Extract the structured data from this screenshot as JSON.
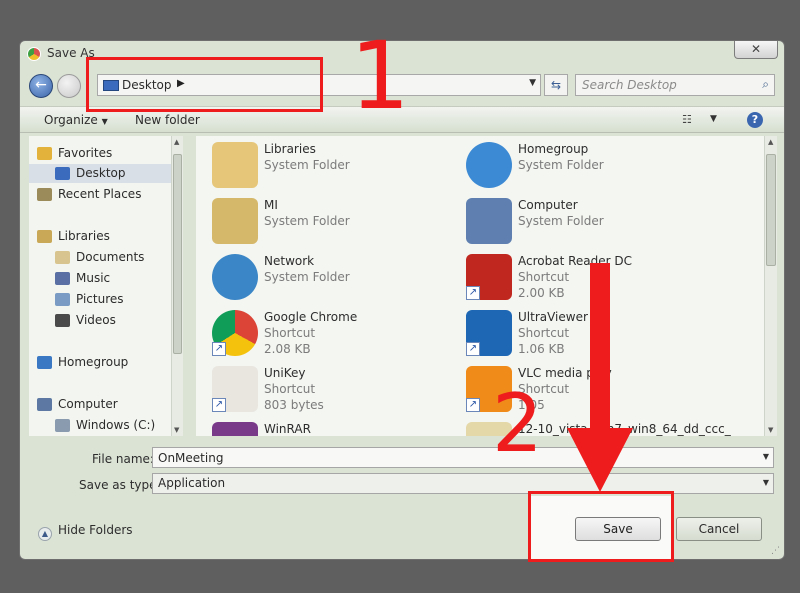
{
  "window": {
    "title": "Save As",
    "close_label": "✕"
  },
  "address_bar": {
    "path": "Desktop"
  },
  "search": {
    "placeholder": "Search Desktop"
  },
  "toolbar": {
    "organize_label": "Organize",
    "new_folder_label": "New folder",
    "help_label": "?"
  },
  "nav_pane": {
    "items": [
      {
        "label": "Favorites",
        "icon": "star-icon",
        "color": "#e2b23a"
      },
      {
        "label": "Desktop",
        "icon": "desktop-icon",
        "color": "#3b6bbd",
        "selected": true
      },
      {
        "label": "Recent Places",
        "icon": "recent-places-icon",
        "color": "#9b8b5a"
      },
      {
        "label": "Libraries",
        "icon": "libraries-icon",
        "color": "#c9a857"
      },
      {
        "label": "Documents",
        "icon": "documents-icon",
        "color": "#d8c48e"
      },
      {
        "label": "Music",
        "icon": "music-icon",
        "color": "#5a6fa3"
      },
      {
        "label": "Pictures",
        "icon": "pictures-icon",
        "color": "#7a9cc4"
      },
      {
        "label": "Videos",
        "icon": "videos-icon",
        "color": "#4a4a4a"
      },
      {
        "label": "Homegroup",
        "icon": "homegroup-icon",
        "color": "#3a78c4"
      },
      {
        "label": "Computer",
        "icon": "computer-icon",
        "color": "#5d79a3"
      },
      {
        "label": "Windows (C:)",
        "icon": "drive-icon",
        "color": "#8a9bb0"
      }
    ]
  },
  "files": [
    {
      "name": "Libraries",
      "type": "System Folder",
      "size": "",
      "icon": "libraries-folder-icon",
      "color": "#e6c77a",
      "shortcut": false
    },
    {
      "name": "Homegroup",
      "type": "System Folder",
      "size": "",
      "icon": "homegroup-icon",
      "color": "#3d8ad4",
      "shortcut": false
    },
    {
      "name": "MI",
      "type": "System Folder",
      "size": "",
      "icon": "user-folder-icon",
      "color": "#d6b86b",
      "shortcut": false
    },
    {
      "name": "Computer",
      "type": "System Folder",
      "size": "",
      "icon": "computer-icon",
      "color": "#5e7fb0",
      "shortcut": false
    },
    {
      "name": "Network",
      "type": "System Folder",
      "size": "",
      "icon": "network-icon",
      "color": "#3b86c6",
      "shortcut": false
    },
    {
      "name": "Acrobat Reader DC",
      "type": "Shortcut",
      "size": "2.00 KB",
      "icon": "acrobat-icon",
      "color": "#c0281f",
      "shortcut": true
    },
    {
      "name": "Google Chrome",
      "type": "Shortcut",
      "size": "2.08 KB",
      "icon": "chrome-icon",
      "color": "#d84a3a",
      "shortcut": true
    },
    {
      "name": "UltraViewer",
      "type": "Shortcut",
      "size": "1.06 KB",
      "icon": "ultraviewer-icon",
      "color": "#1e67b5",
      "shortcut": true
    },
    {
      "name": "UniKey",
      "type": "Shortcut",
      "size": "803 bytes",
      "icon": "unikey-icon",
      "color": "#e9e6e0",
      "shortcut": true
    },
    {
      "name": "VLC media play",
      "type": "Shortcut",
      "size": "1.05",
      "icon": "vlc-icon",
      "color": "#f08a18",
      "shortcut": true
    },
    {
      "name": "WinRAR",
      "type": "",
      "size": "",
      "icon": "winrar-icon",
      "color": "#7a3a8a",
      "shortcut": false
    },
    {
      "name": "12-10_vista_win7_win8_64_dd_ccc_",
      "type": "",
      "size": "",
      "icon": "file-icon",
      "color": "#e4d7a8",
      "shortcut": false
    }
  ],
  "form": {
    "file_name_label": "File name:",
    "file_name_value": "OnMeeting",
    "save_as_type_label": "Save as type:",
    "save_as_type_value": "Application"
  },
  "footer": {
    "hide_folders_label": "Hide Folders",
    "save_label": "Save",
    "cancel_label": "Cancel"
  },
  "annotations": {
    "marker_1": "1",
    "marker_2": "2",
    "color": "#ee1c1c"
  }
}
